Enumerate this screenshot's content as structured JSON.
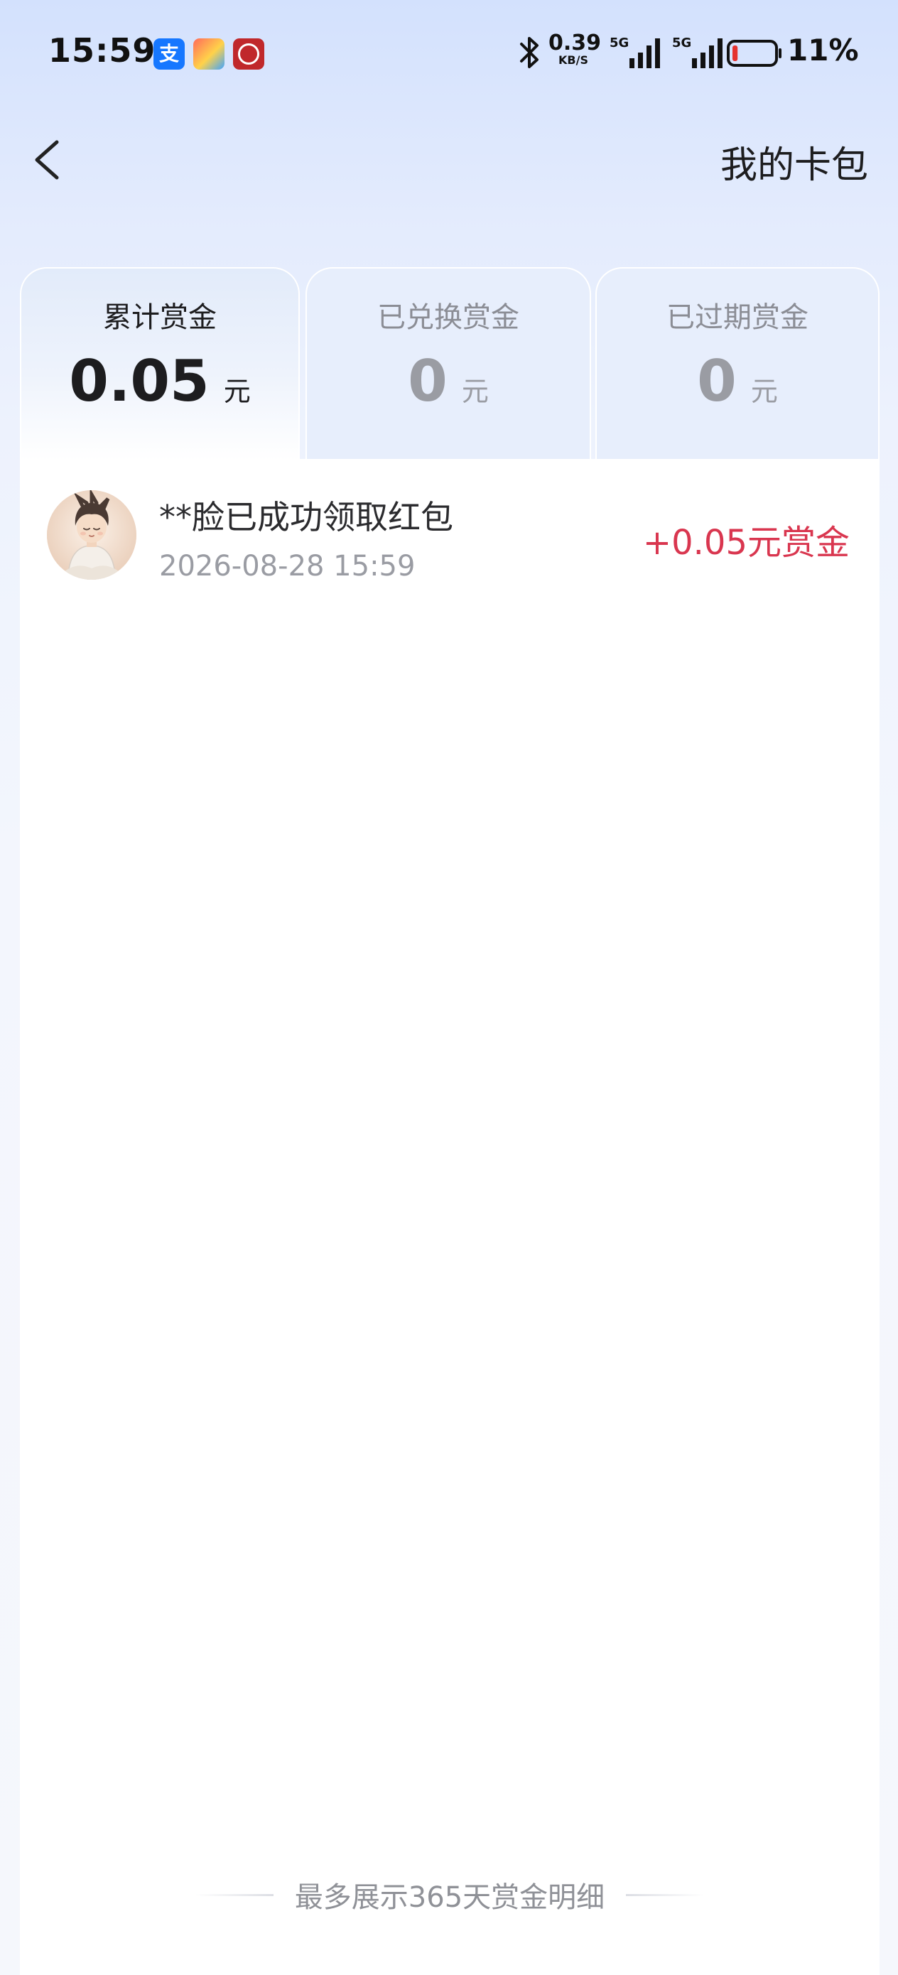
{
  "status_bar": {
    "time": "15:59",
    "app_icons": [
      "alipay-icon",
      "game-app-icon",
      "bank-app-icon"
    ],
    "alipay_glyph": "支",
    "net_speed_value": "0.39",
    "net_speed_unit": "KB/S",
    "signal_1_label": "5G",
    "signal_2_label": "5G",
    "battery_percent": "11%",
    "battery_level": 0.11,
    "battery_color": "#e5322f"
  },
  "header": {
    "title": "我的卡包",
    "back_icon": "chevron-left-icon"
  },
  "summary_tabs": [
    {
      "label": "累计赏金",
      "value": "0.05",
      "unit": "元",
      "active": true
    },
    {
      "label": "已兑换赏金",
      "value": "0",
      "unit": "元",
      "active": false
    },
    {
      "label": "已过期赏金",
      "value": "0",
      "unit": "元",
      "active": false
    }
  ],
  "records": [
    {
      "title": "**脸已成功领取红包",
      "time": "2026-08-28 15:59",
      "amount": "+0.05元赏金"
    }
  ],
  "footer_note": "最多展示365天赏金明细",
  "colors": {
    "accent_red": "#d9364f",
    "background_top": "#d3e1fd",
    "muted_text": "#9a9ca3"
  }
}
